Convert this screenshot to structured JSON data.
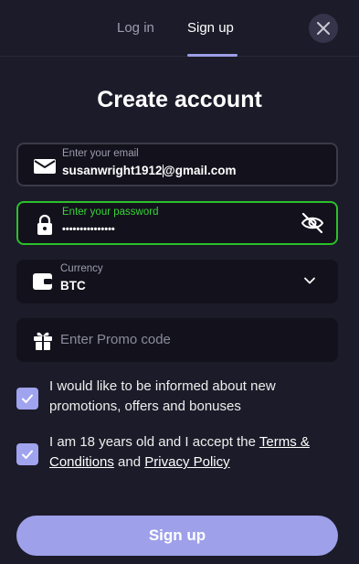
{
  "tabs": {
    "login": "Log in",
    "signup": "Sign up"
  },
  "title": "Create account",
  "email": {
    "label": "Enter your email",
    "value_before_caret": "susanwright1912",
    "value_after_caret": "@gmail.com"
  },
  "password": {
    "label": "Enter your password",
    "value": "•••••••••••••••"
  },
  "currency": {
    "label": "Currency",
    "value": "BTC"
  },
  "promo": {
    "placeholder": "Enter Promo code"
  },
  "consent_marketing": {
    "text": "I would like to be informed about new promotions, offers and bonuses",
    "checked": true
  },
  "consent_terms": {
    "prefix": "I am 18 years old and I accept the ",
    "terms_link": "Terms & Conditions",
    "middle": " and ",
    "privacy_link": "Privacy Policy",
    "checked": true
  },
  "submit_label": "Sign up",
  "colors": {
    "background": "#1c1b29",
    "field": "#13121c",
    "accent": "#9ea0ea",
    "focus": "#2bc02b"
  }
}
